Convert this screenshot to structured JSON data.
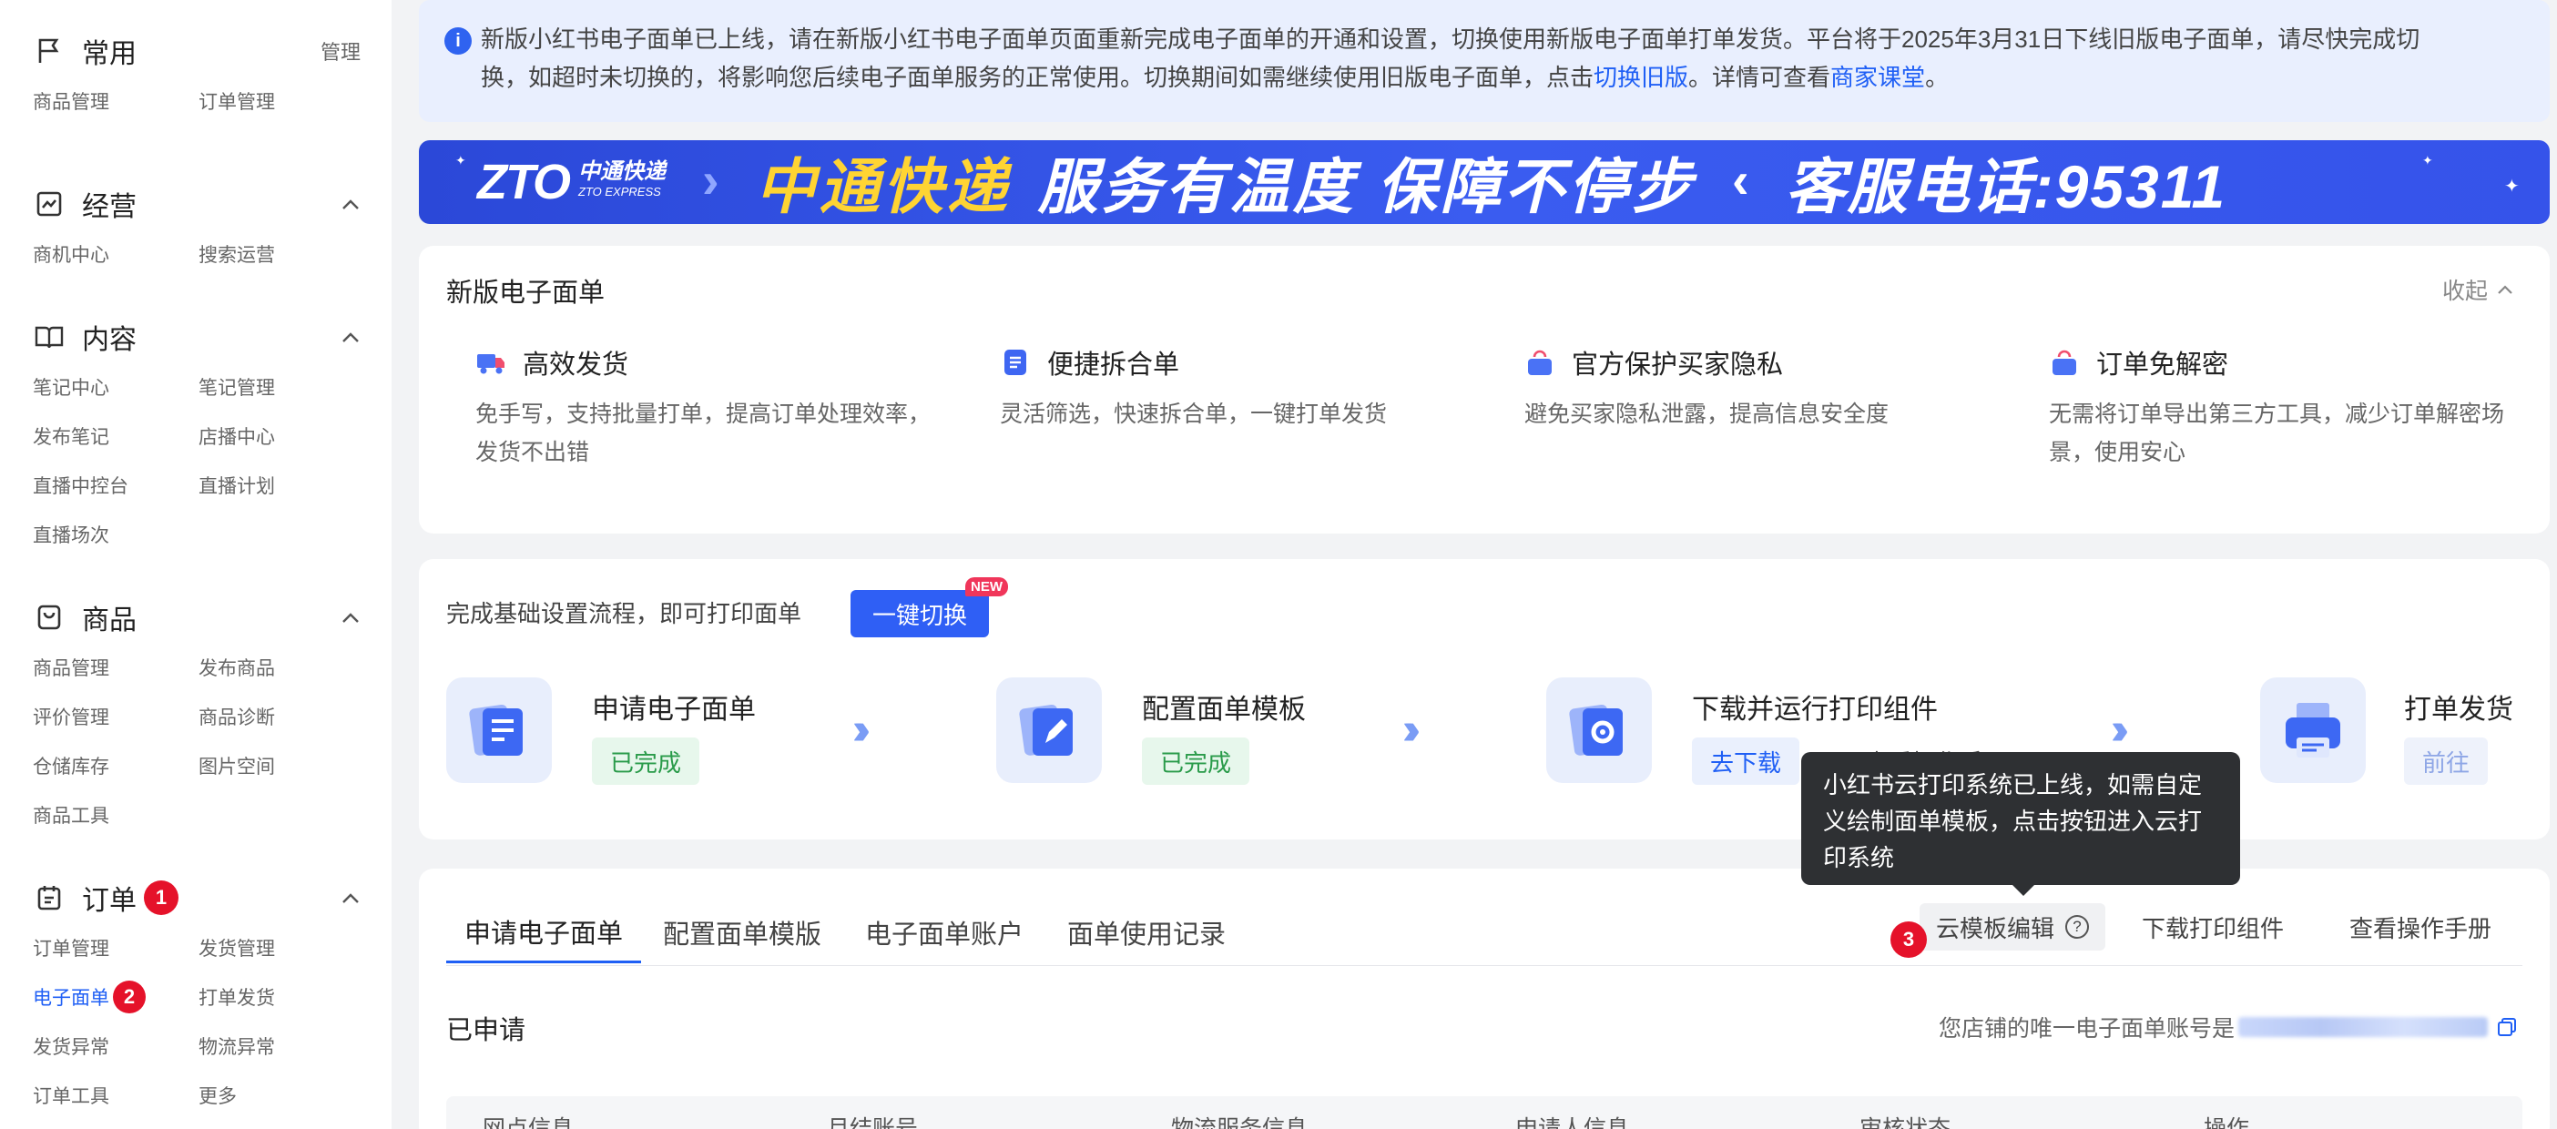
{
  "sidebar": {
    "common": {
      "title": "常用",
      "manage": "管理",
      "items": [
        "商品管理",
        "订单管理"
      ]
    },
    "ops": {
      "title": "经营",
      "items": [
        "商机中心",
        "搜索运营"
      ]
    },
    "content": {
      "title": "内容",
      "items": [
        "笔记中心",
        "笔记管理",
        "发布笔记",
        "店播中心",
        "直播中控台",
        "直播计划",
        "直播场次"
      ]
    },
    "goods": {
      "title": "商品",
      "items": [
        "商品管理",
        "发布商品",
        "评价管理",
        "商品诊断",
        "仓储库存",
        "图片空间",
        "商品工具"
      ]
    },
    "orders": {
      "title": "订单",
      "badge": "1",
      "items": [
        "订单管理",
        "发货管理",
        "电子面单",
        "打单发货",
        "发货异常",
        "物流异常",
        "订单工具",
        "更多"
      ],
      "active_badge": "2"
    }
  },
  "notice": {
    "text1": "新版小红书电子面单已上线，请在新版小红书电子面单页面重新完成电子面单的开通和设置，切换使用新版电子面单打单发货。平台将于2025年3月31日下线旧版电子面单，请尽快完成切",
    "text2": "换，如超时未切换的，将影响您后续电子面单服务的正常使用。切换期间如需继续使用旧版电子面单，点击",
    "link1": "切换旧版",
    "text3": "。详情可查看",
    "link2": "商家课堂",
    "text4": "。"
  },
  "banner": {
    "logo": "ZTO",
    "logo_cn": "中通快递",
    "logo_en": "ZTO EXPRESS",
    "brand": "中通快递",
    "slogan": "服务有温度 保障不停步",
    "phone": "客服电话:95311"
  },
  "features": {
    "title": "新版电子面单",
    "collapse": "收起",
    "items": [
      {
        "title": "高效发货",
        "desc": "免手写，支持批量打单，提高订单处理效率，发货不出错"
      },
      {
        "title": "便捷拆合单",
        "desc": "灵活筛选，快速拆合单，一键打单发货"
      },
      {
        "title": "官方保护买家隐私",
        "desc": "避免买家隐私泄露，提高信息安全度"
      },
      {
        "title": "订单免解密",
        "desc": "无需将订单导出第三方工具，减少订单解密场景，使用安心"
      }
    ]
  },
  "setup": {
    "title": "完成基础设置流程，即可打印面单",
    "switch_btn": "一键切换",
    "new_tag": "NEW",
    "steps": [
      {
        "title": "申请电子面单",
        "tag": "已完成"
      },
      {
        "title": "配置面单模板",
        "tag": "已完成"
      },
      {
        "title": "下载并运行打印组件",
        "tag": "去下载",
        "extra": "查看操作手册"
      },
      {
        "title": "打单发货",
        "tag": "前往"
      }
    ]
  },
  "tabs": {
    "items": [
      "申请电子面单",
      "配置面单模版",
      "电子面单账户",
      "面单使用记录"
    ],
    "cloud_btn": "云模板编辑",
    "download_btn": "下载打印组件",
    "manual_btn": "查看操作手册",
    "marker": "3"
  },
  "tooltip": {
    "text": "小红书云打印系统已上线，如需自定义绘制面单模板，点击按钮进入云打印系统"
  },
  "applied": {
    "title": "已申请",
    "account_label": "您店铺的唯一电子面单账号是",
    "columns": [
      "网点信息",
      "月结账号",
      "物流服务信息",
      "申请人信息",
      "审核状态",
      "操作"
    ]
  },
  "colors": {
    "accent": "#1f5ff5",
    "badge": "#e5122a",
    "done": "#2a9b4a"
  }
}
